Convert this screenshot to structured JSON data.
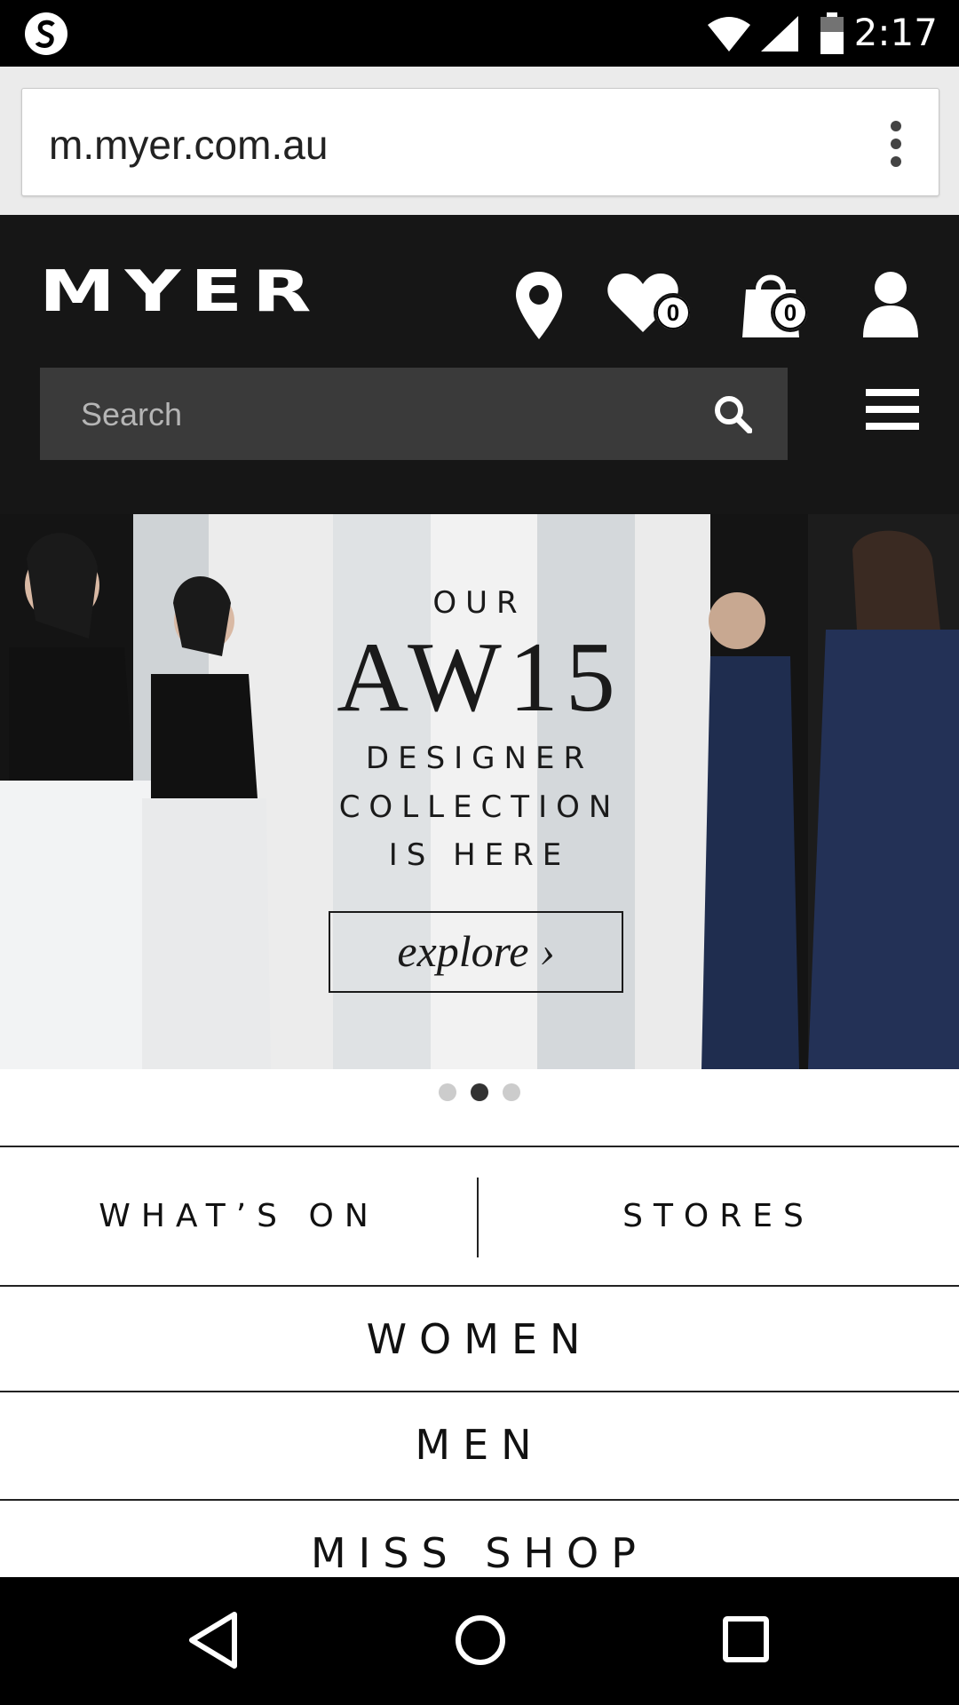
{
  "status_bar": {
    "time": "2:17"
  },
  "browser": {
    "url": "m.myer.com.au"
  },
  "header": {
    "logo": "MYER",
    "wishlist_count": "0",
    "bag_count": "0",
    "search_placeholder": "Search"
  },
  "banner": {
    "line1": "OUR",
    "line2": "AW15",
    "line3": "DESIGNER",
    "line4": "COLLECTION",
    "line5": "IS HERE",
    "cta": "explore ›",
    "slides": 3,
    "active_slide": 2
  },
  "nav": {
    "whats_on": "WHAT’S ON",
    "stores": "STORES",
    "women": "WOMEN",
    "men": "MEN",
    "miss_shop": "MISS SHOP"
  },
  "colors": {
    "header_bg": "#161616",
    "search_bg": "#3a3a3a",
    "accent": "#000000"
  }
}
